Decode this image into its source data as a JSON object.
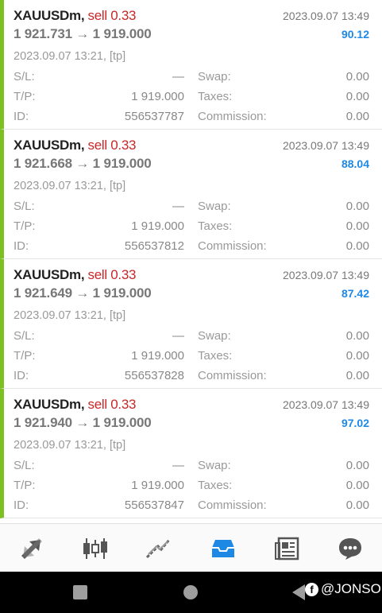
{
  "trades": [
    {
      "symbol": "XAUUSDm",
      "side": "sell 0.33",
      "close_time": "2023.09.07 13:49",
      "prices": "1 921.731 → 1 919.000",
      "profit": "90.12",
      "open_info": "2023.09.07 13:21, [tp]",
      "sl": "—",
      "tp": "1 919.000",
      "id": "556537787",
      "swap": "0.00",
      "taxes": "0.00",
      "commission": "0.00"
    },
    {
      "symbol": "XAUUSDm",
      "side": "sell 0.33",
      "close_time": "2023.09.07 13:49",
      "prices": "1 921.668 → 1 919.000",
      "profit": "88.04",
      "open_info": "2023.09.07 13:21, [tp]",
      "sl": "—",
      "tp": "1 919.000",
      "id": "556537812",
      "swap": "0.00",
      "taxes": "0.00",
      "commission": "0.00"
    },
    {
      "symbol": "XAUUSDm",
      "side": "sell 0.33",
      "close_time": "2023.09.07 13:49",
      "prices": "1 921.649 → 1 919.000",
      "profit": "87.42",
      "open_info": "2023.09.07 13:21, [tp]",
      "sl": "—",
      "tp": "1 919.000",
      "id": "556537828",
      "swap": "0.00",
      "taxes": "0.00",
      "commission": "0.00"
    },
    {
      "symbol": "XAUUSDm",
      "side": "sell 0.33",
      "close_time": "2023.09.07 13:49",
      "prices": "1 921.940 → 1 919.000",
      "profit": "97.02",
      "open_info": "2023.09.07 13:21, [tp]",
      "sl": "—",
      "tp": "1 919.000",
      "id": "556537847",
      "swap": "0.00",
      "taxes": "0.00",
      "commission": "0.00"
    }
  ],
  "labels": {
    "sl": "S/L:",
    "tp": "T/P:",
    "id": "ID:",
    "swap": "Swap:",
    "taxes": "Taxes:",
    "commission": "Commission:"
  },
  "toolbar": {
    "items": [
      "quotes-icon",
      "chart-icon",
      "trade-icon",
      "history-icon",
      "news-icon",
      "chat-icon"
    ],
    "active": "history-icon"
  },
  "colors": {
    "accent": "#1e88e5",
    "sell": "#c62828",
    "bar": "#7cc11f"
  },
  "watermark": {
    "text": "@JONSO"
  }
}
